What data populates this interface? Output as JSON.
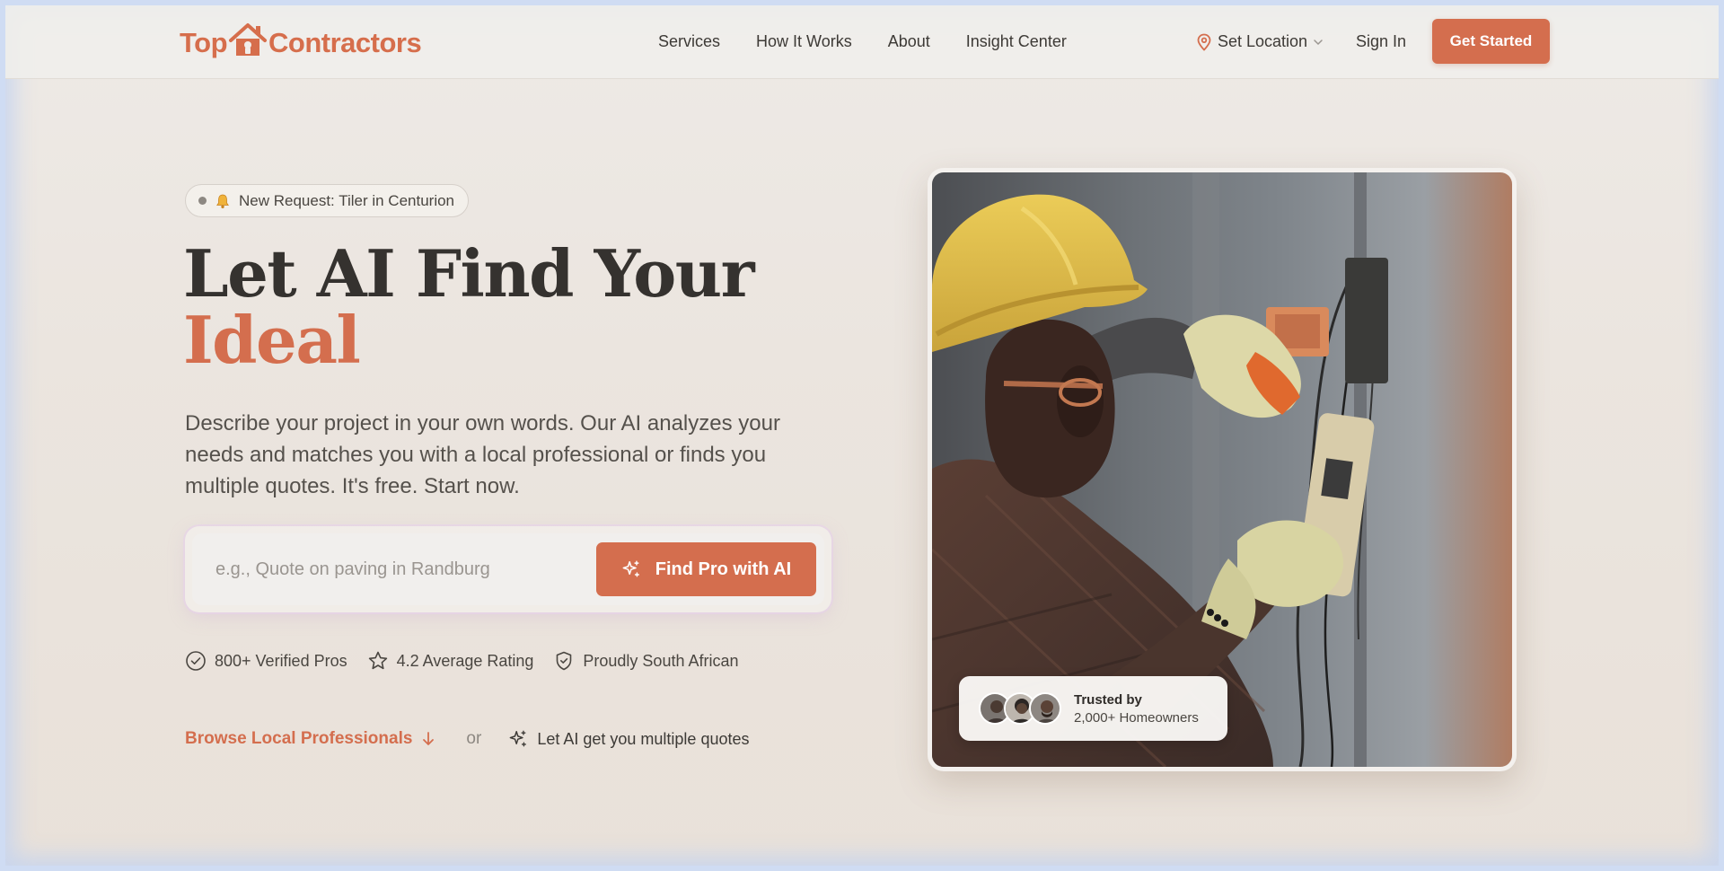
{
  "header": {
    "logo_left": "Top",
    "logo_right": "Contractors",
    "nav": [
      "Services",
      "How It Works",
      "About",
      "Insight Center"
    ],
    "location_label": "Set Location",
    "signin_label": "Sign In",
    "cta_label": "Get Started"
  },
  "hero": {
    "pill_text": "New Request: Tiler in Centurion",
    "title_line1": "Let AI Find Your",
    "title_line2": "Ideal",
    "description": "Describe your project in your own words. Our AI analyzes your needs and matches you with a local professional or finds you multiple quotes. It's free. Start now.",
    "search": {
      "placeholder": "e.g., Quote on paving in Randburg",
      "value": "",
      "button_label": "Find Pro with AI"
    },
    "badges": [
      "800+ Verified Pros",
      "4.2 Average Rating",
      "Proudly South African"
    ],
    "browse_label": "Browse Local Professionals",
    "or_label": "or",
    "ai_quotes_label": "Let AI get you multiple quotes"
  },
  "image_card": {
    "trusted_title": "Trusted by",
    "trusted_subtitle": "2,000+ Homeowners"
  },
  "icons": {
    "logo": "house-icon",
    "location": "map-pin-icon",
    "dropdown": "chevron-down-icon",
    "pill": "bell-icon",
    "ai": "sparkles-icon",
    "badge1": "check-circle-icon",
    "badge2": "star-icon",
    "badge3": "shield-check-icon",
    "browse": "arrow-down-icon"
  },
  "colors": {
    "accent": "#d46e4e",
    "text_dark": "#35322f",
    "background": "#ebe5df"
  }
}
